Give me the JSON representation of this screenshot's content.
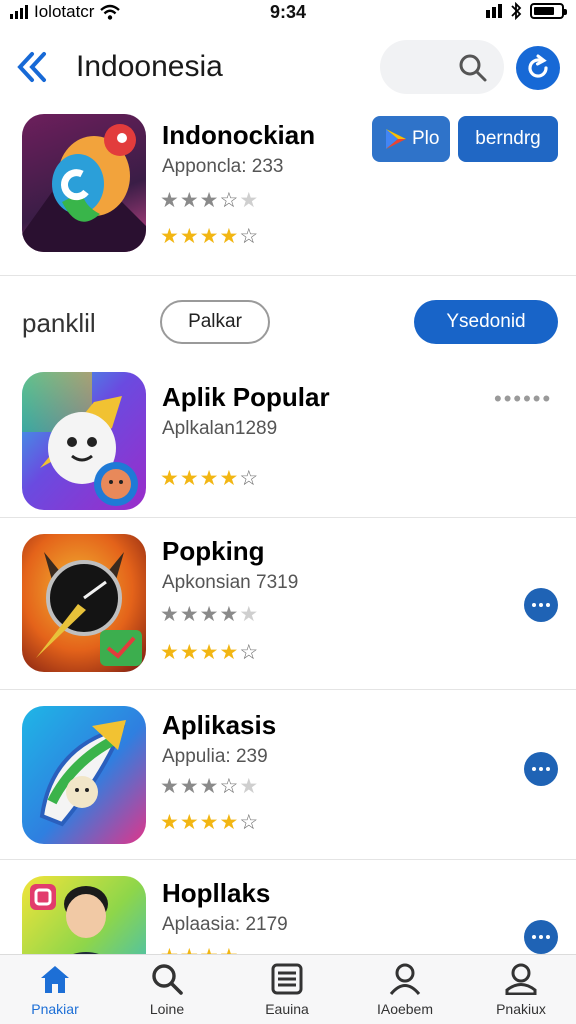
{
  "status_bar": {
    "carrier": "Iolotatcr",
    "time": "9:34",
    "battery_level": 0.78
  },
  "header": {
    "title": "Indoonesia",
    "back_icon": "chevron-left-icon",
    "search_icon": "search-icon",
    "refresh_icon": "refresh-icon"
  },
  "featured": {
    "name": "Indonockian",
    "subtitle": "Apponcla: 233",
    "rating_gray": 3.5,
    "rating_gold": 3.5,
    "play_label": "Plo",
    "primary_label": "berndrg"
  },
  "section": {
    "title": "panklil",
    "outline_label": "Palkar",
    "pill_label": "Ysedonid"
  },
  "list": [
    {
      "name": "Aplik Popular",
      "subtitle": "Aplkalan1289",
      "rating_gold": 4
    },
    {
      "name": "Popking",
      "subtitle": "Apkonsian 7319",
      "rating_gray": 4,
      "rating_gold": 4
    },
    {
      "name": "Aplikasis",
      "subtitle": "Appulia: 239",
      "rating_gray": 3.5,
      "rating_gold": 4
    },
    {
      "name": "Hopllaks",
      "subtitle": "Aplaasia: 2179"
    }
  ],
  "tabs": [
    {
      "label": "Pnakiar",
      "icon": "home-icon",
      "active": true
    },
    {
      "label": "Loine",
      "icon": "search-icon",
      "active": false
    },
    {
      "label": "Eauina",
      "icon": "list-icon",
      "active": false
    },
    {
      "label": "IAoebem",
      "icon": "person-icon",
      "active": false
    },
    {
      "label": "Pnakiux",
      "icon": "profile-icon",
      "active": false
    }
  ],
  "colors": {
    "accent": "#1769d6",
    "star_gold": "#f2b613",
    "star_gray": "#8a8a8a"
  }
}
